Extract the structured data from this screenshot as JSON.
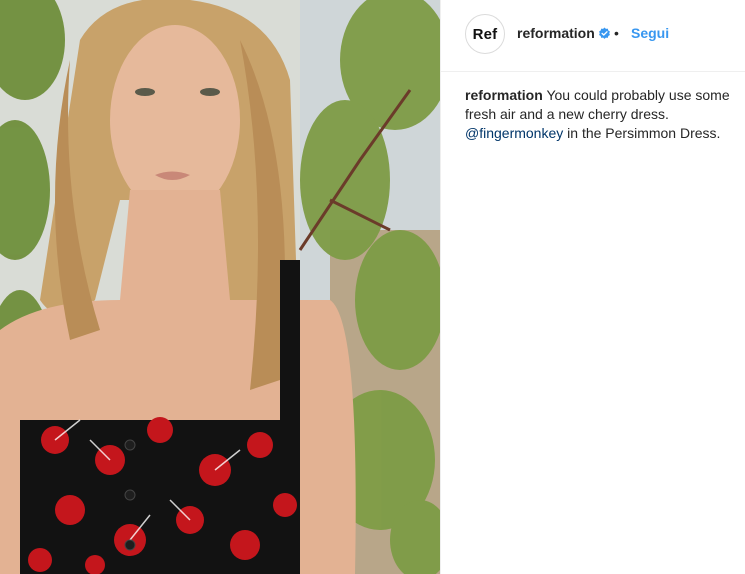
{
  "post": {
    "image_alt": "Woman in cherry print dress among shrubs",
    "header": {
      "avatar_text": "Ref",
      "username": "reformation",
      "verified_icon": "verified-badge-icon",
      "separator": "•",
      "follow_label": "Segui"
    },
    "caption": {
      "username": "reformation",
      "text_part1": "You could probably use some fresh air and a new cherry dress.",
      "mention": "@fingermonkey",
      "text_part2": "in the Persimmon Dress."
    }
  },
  "colors": {
    "link_blue": "#3897f0",
    "mention_blue": "#003569",
    "verified_blue": "#3897f0"
  }
}
